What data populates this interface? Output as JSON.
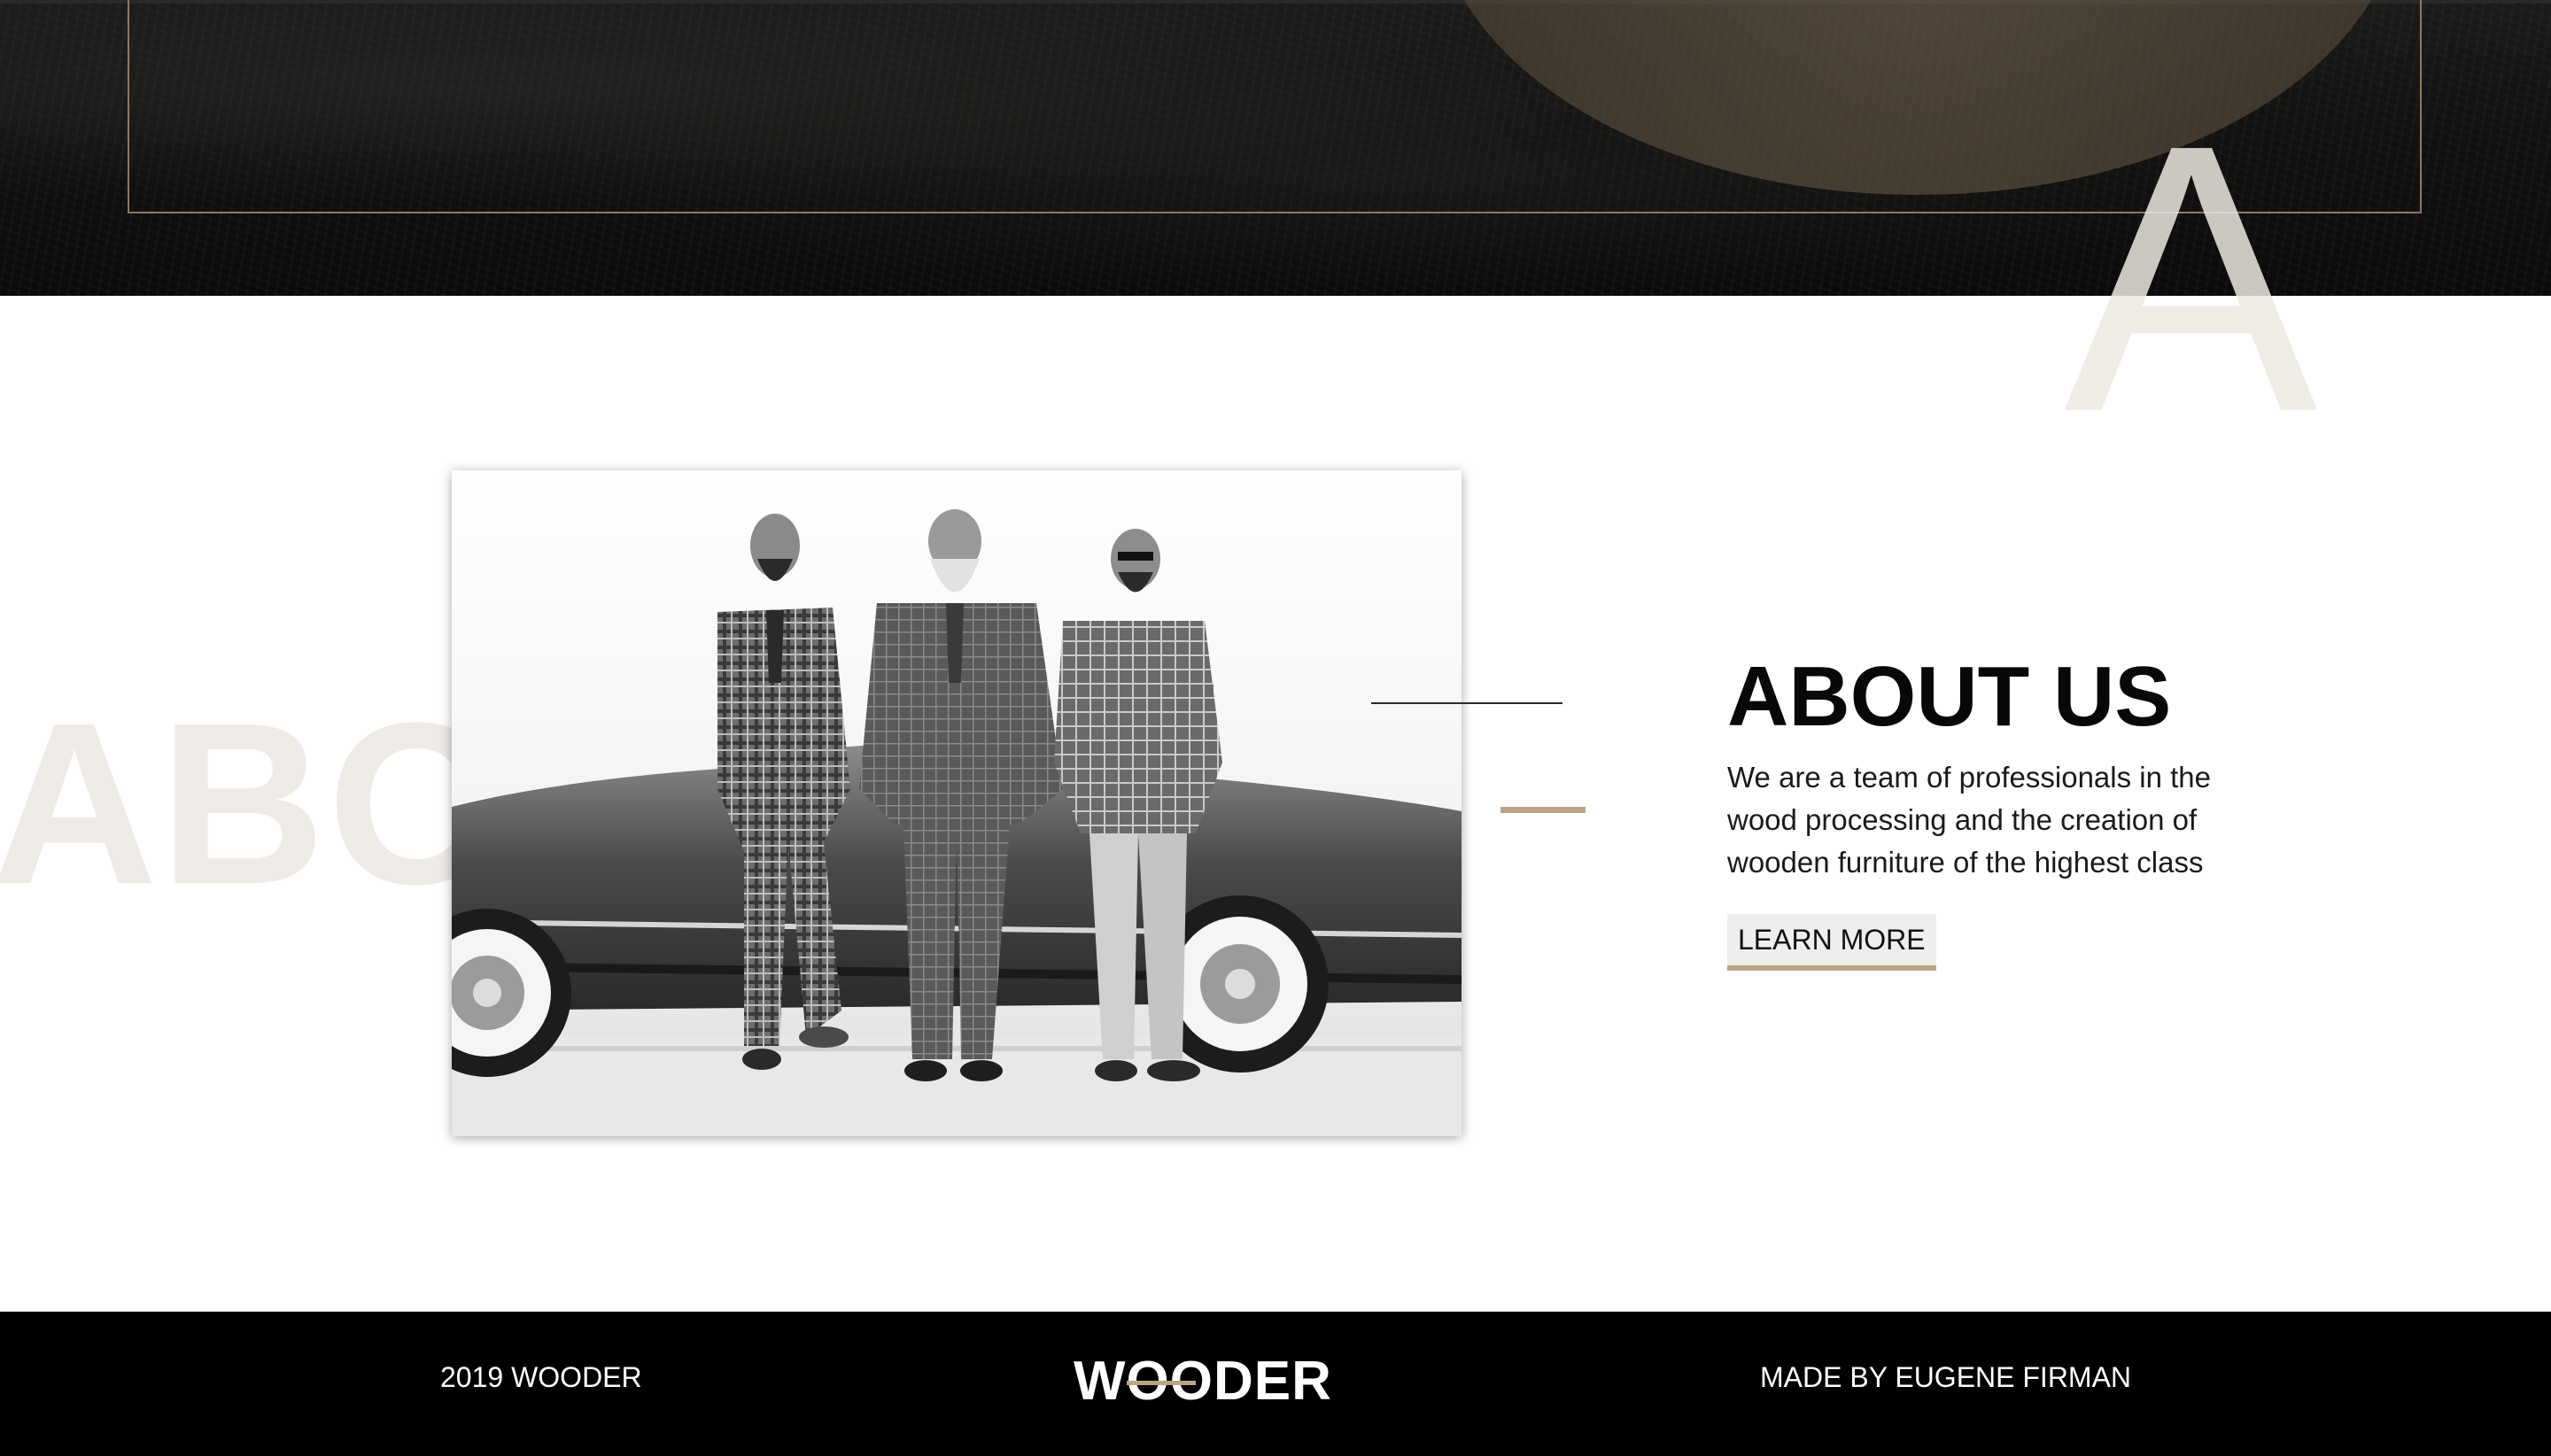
{
  "hero": {
    "ghost_letter": "A"
  },
  "about": {
    "ghost_word": "ABOUT",
    "title": "ABOUT US",
    "text": "We are a team of professionals in the wood processing and the creation of wooden furniture of the highest class",
    "button_label": "LEARN MORE",
    "photo_alt": "Three men in suits leaning on a vintage car"
  },
  "footer": {
    "left_text": "2019 WOODER",
    "logo": "WOODER",
    "right_text": "MADE BY EUGENE FIRMAN"
  },
  "colors": {
    "accent_gold": "#bba583",
    "hero_dark": "#111110",
    "footer_bg": "#000000",
    "ghost_text": "#eeeae5"
  }
}
